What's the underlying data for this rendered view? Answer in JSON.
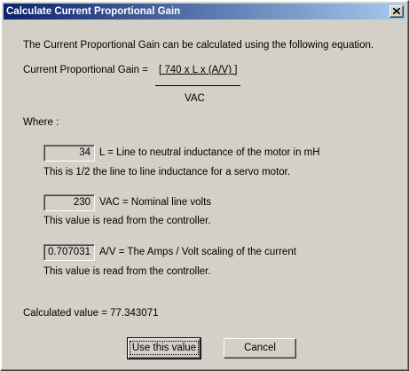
{
  "window": {
    "title": "Calculate Current Proportional Gain"
  },
  "intro": "The Current Proportional Gain can be calculated using the following equation.",
  "equation": {
    "lhs": "Current Proportional Gain =",
    "numerator": "[ 740 x L x (A/V) ]",
    "denominator": "VAC"
  },
  "where_label": "Where :",
  "params": [
    {
      "value": "34",
      "label": "L = Line to neutral inductance of the motor in mH",
      "note": "This is 1/2 the line to line inductance for a servo motor."
    },
    {
      "value": "230",
      "label": "VAC = Nominal line volts",
      "note": "This value is read from the controller."
    },
    {
      "value": "0.707031",
      "label": "A/V = The Amps / Volt scaling of the current",
      "note": "This value is read from the controller."
    }
  ],
  "result": "Calculated value  = 77.343071",
  "buttons": {
    "use_value": "Use this value",
    "cancel": "Cancel"
  },
  "icons": {
    "close": "close-icon"
  }
}
